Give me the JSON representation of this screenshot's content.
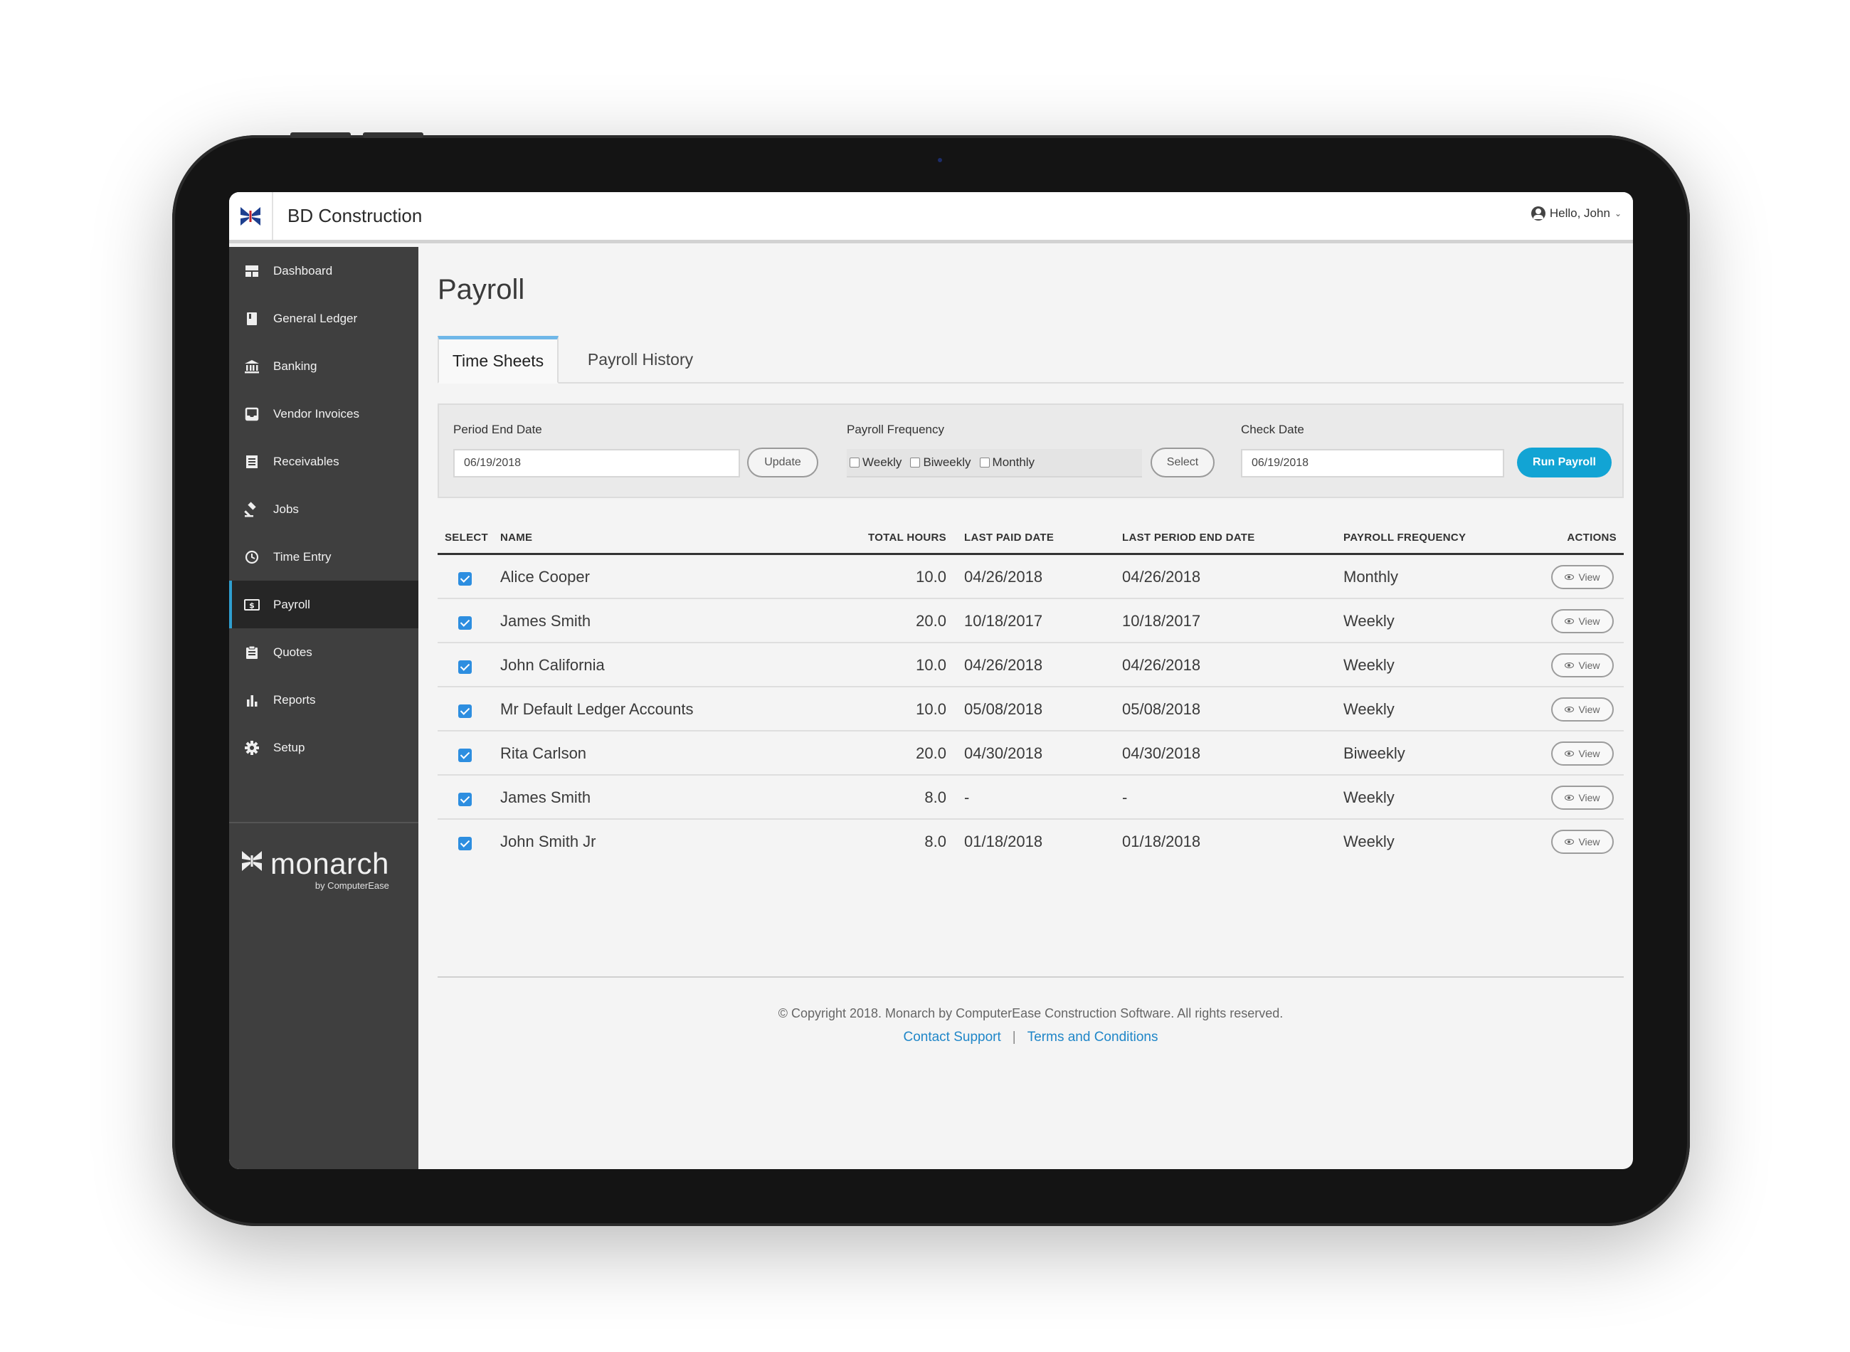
{
  "header": {
    "company": "BD Construction",
    "greeting": "Hello, John"
  },
  "sidebar": {
    "items": [
      {
        "label": "Dashboard",
        "icon": "dashboard-icon"
      },
      {
        "label": "General Ledger",
        "icon": "ledger-icon"
      },
      {
        "label": "Banking",
        "icon": "bank-icon"
      },
      {
        "label": "Vendor Invoices",
        "icon": "inbox-icon"
      },
      {
        "label": "Receivables",
        "icon": "list-icon"
      },
      {
        "label": "Jobs",
        "icon": "gavel-icon"
      },
      {
        "label": "Time Entry",
        "icon": "clock-icon"
      },
      {
        "label": "Payroll",
        "icon": "dollar-icon",
        "active": true
      },
      {
        "label": "Quotes",
        "icon": "clipboard-icon"
      },
      {
        "label": "Reports",
        "icon": "bar-chart-icon"
      },
      {
        "label": "Setup",
        "icon": "gear-icon"
      }
    ],
    "brand": {
      "name": "monarch",
      "by": "by ComputerEase"
    }
  },
  "main": {
    "title": "Payroll",
    "tabs": [
      "Time Sheets",
      "Payroll History"
    ],
    "filter": {
      "period_end_label": "Period End Date",
      "period_end_value": "06/19/2018",
      "update_label": "Update",
      "frequency_label": "Payroll Frequency",
      "frequency_options": [
        "Weekly",
        "Biweekly",
        "Monthly"
      ],
      "select_label": "Select",
      "check_date_label": "Check Date",
      "check_date_value": "06/19/2018",
      "run_label": "Run Payroll"
    },
    "table": {
      "headers": [
        "SELECT",
        "NAME",
        "TOTAL HOURS",
        "LAST PAID DATE",
        "LAST PERIOD END DATE",
        "PAYROLL FREQUENCY",
        "ACTIONS"
      ],
      "view_label": "View",
      "rows": [
        {
          "name": "Alice Cooper",
          "hours": "10.0",
          "last_paid": "04/26/2018",
          "last_period_end": "04/26/2018",
          "frequency": "Monthly"
        },
        {
          "name": "James Smith",
          "hours": "20.0",
          "last_paid": "10/18/2017",
          "last_period_end": "10/18/2017",
          "frequency": "Weekly"
        },
        {
          "name": "John California",
          "hours": "10.0",
          "last_paid": "04/26/2018",
          "last_period_end": "04/26/2018",
          "frequency": "Weekly"
        },
        {
          "name": "Mr Default Ledger Accounts",
          "hours": "10.0",
          "last_paid": "05/08/2018",
          "last_period_end": "05/08/2018",
          "frequency": "Weekly"
        },
        {
          "name": "Rita Carlson",
          "hours": "20.0",
          "last_paid": "04/30/2018",
          "last_period_end": "04/30/2018",
          "frequency": "Biweekly"
        },
        {
          "name": "James Smith",
          "hours": "8.0",
          "last_paid": "-",
          "last_period_end": "-",
          "frequency": "Weekly"
        },
        {
          "name": "John Smith Jr",
          "hours": "8.0",
          "last_paid": "01/18/2018",
          "last_period_end": "01/18/2018",
          "frequency": "Weekly"
        }
      ]
    }
  },
  "footer": {
    "copyright": "© Copyright 2018. Monarch by ComputerEase Construction Software. All rights reserved.",
    "contact": "Contact Support",
    "separator": "|",
    "terms": "Terms and Conditions"
  },
  "colors": {
    "accent": "#12a4d4",
    "sidebar": "#3f3f3f",
    "link": "#1f86c8",
    "check": "#2d8ee0"
  }
}
